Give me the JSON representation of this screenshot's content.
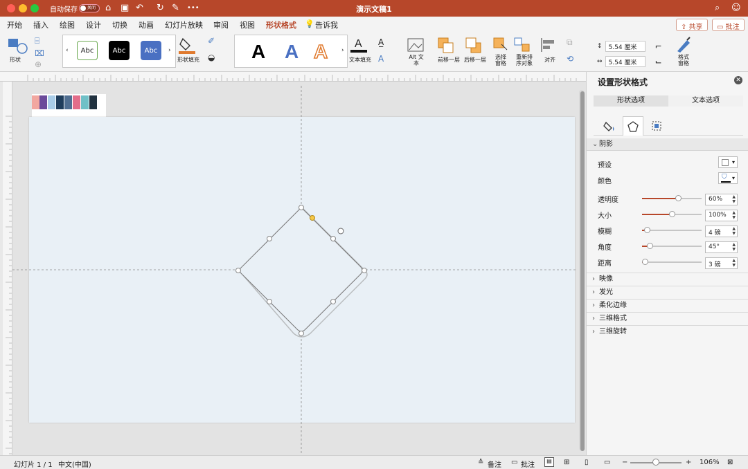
{
  "titlebar": {
    "autosave_label": "自动保存",
    "autosave_toggle": "关闭",
    "doc_title": "演示文稿1"
  },
  "tabs": [
    "开始",
    "插入",
    "绘图",
    "设计",
    "切换",
    "动画",
    "幻灯片放映",
    "审阅",
    "视图",
    "形状格式",
    "告诉我"
  ],
  "active_tab": "形状格式",
  "share_label": "共享",
  "comment_label": "批注",
  "ribbon": {
    "shapes_label": "形状",
    "style_chips": [
      "Abc",
      "Abc",
      "Abc"
    ],
    "shape_fill_label": "形状填充",
    "wordart": [
      "A",
      "A",
      "A"
    ],
    "text_fill_label": "文本填充",
    "alt_text_label": "Alt 文本",
    "bring_forward_label": "前移一层",
    "send_backward_label": "后移一层",
    "selection_pane_label": "选择 窗格",
    "reorder_label": "重新排 序对象",
    "align_label": "对齐",
    "height_value": "5.54 厘米",
    "width_value": "5.54 厘米",
    "format_pane_label": "格式 窗格"
  },
  "pane": {
    "title": "设置形状格式",
    "seg_shape": "形状选项",
    "seg_text": "文本选项",
    "section_shadow": "阴影",
    "preset_label": "预设",
    "color_label": "颜色",
    "props": [
      {
        "label": "透明度",
        "value": "60%",
        "level": 0.6
      },
      {
        "label": "大小",
        "value": "100%",
        "level": 0.5
      },
      {
        "label": "模糊",
        "value": "4 磅",
        "level": 0.08
      },
      {
        "label": "角度",
        "value": "45°",
        "level": 0.13
      },
      {
        "label": "距离",
        "value": "3 磅",
        "level": 0.05
      }
    ],
    "collapsed_sections": [
      "映像",
      "发光",
      "柔化边缘",
      "三维格式",
      "三维旋转"
    ]
  },
  "palette_colors": [
    "#f2a7a0",
    "#6a4a9a",
    "#a9cde9",
    "#1f3d5c",
    "#4f6e91",
    "#e36d8a",
    "#6fc0c7",
    "#213240"
  ],
  "status": {
    "slide_info": "幻灯片 1 / 1",
    "language": "中文(中国)",
    "notes": "备注",
    "comments": "批注",
    "zoom": "106%"
  },
  "colors": {
    "accent": "#b7472a"
  }
}
